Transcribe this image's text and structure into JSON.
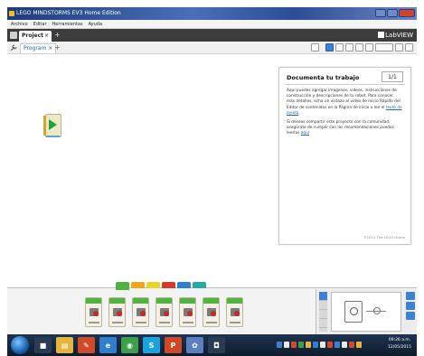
{
  "window": {
    "title": "LEGO MINDSTORMS EV3 Home Edition"
  },
  "menu": [
    "Archivo",
    "Editar",
    "Herramientas",
    "Ayuda"
  ],
  "project": {
    "tab_label": "Project",
    "close_glyph": "×",
    "add_glyph": "+",
    "brand": "LabVIEW"
  },
  "program": {
    "tab_label": "Program",
    "close_glyph": "×",
    "add_glyph": "+"
  },
  "doc_panel": {
    "title": "Documenta tu trabajo",
    "page": "1/1",
    "para1": "Aquí puedes agregar imágenes, videos, instrucciones de construcción y descripciones de tu robot. Para conocer más detalles, echa un vistazo al video de Inicio Rápido del Editor de contenidos en la Página de inicio o lee el",
    "para1_link": "texto de ayuda",
    "para2": "Si deseas compartir este proyecto con la comunidad, asegúrate de cumplir con las recomendaciones puedes leerlas",
    "para2_link": "aquí",
    "footer": "©2014 The LEGO Group"
  },
  "palette": {
    "category_colors": [
      "#4fb43f",
      "#f2a51c",
      "#e8d52a",
      "#d23a2a",
      "#2f7fd0",
      "#2ba6a8"
    ],
    "blocks": [
      {
        "icon": "medium-motor-block-icon"
      },
      {
        "icon": "large-motor-block-icon"
      },
      {
        "icon": "move-steering-block-icon"
      },
      {
        "icon": "move-tank-block-icon"
      },
      {
        "icon": "display-block-icon"
      },
      {
        "icon": "sound-block-icon"
      },
      {
        "icon": "brick-status-light-block-icon"
      }
    ]
  },
  "taskbar": {
    "apps": [
      {
        "name": "stop-app-icon",
        "color": "#ffffff",
        "glyph": "■"
      },
      {
        "name": "explorer-app-icon",
        "color": "#e6b43a",
        "glyph": "▤"
      },
      {
        "name": "paint-app-icon",
        "color": "#d04a2a",
        "glyph": "✎"
      },
      {
        "name": "internet-explorer-app-icon",
        "color": "#2f7fd0",
        "glyph": "e"
      },
      {
        "name": "chrome-app-icon",
        "color": "#3ba048",
        "glyph": "◉"
      },
      {
        "name": "skype-app-icon",
        "color": "#1aa3e0",
        "glyph": "S"
      },
      {
        "name": "powerpoint-app-icon",
        "color": "#d24726",
        "glyph": "P"
      },
      {
        "name": "media-app-icon",
        "color": "#5a7fc0",
        "glyph": "✿"
      },
      {
        "name": "ev3-app-icon",
        "color": "#ffffff",
        "glyph": "◘"
      }
    ],
    "time": "09:26 a.m.",
    "date": "12/05/2015"
  }
}
